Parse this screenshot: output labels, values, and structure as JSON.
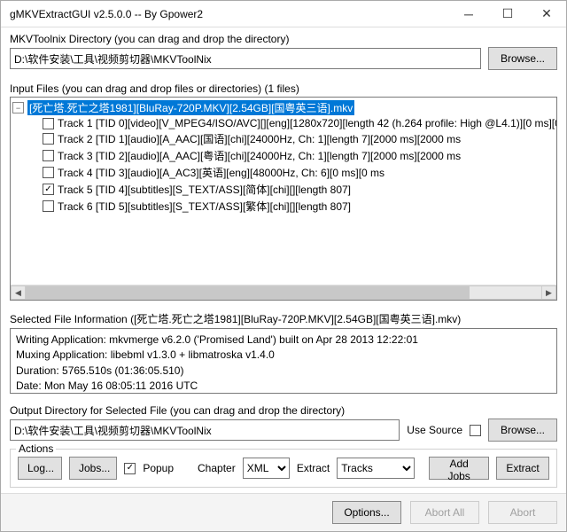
{
  "window": {
    "title": "gMKVExtractGUI v2.5.0.0 -- By Gpower2"
  },
  "mkvtoolnix": {
    "label": "MKVToolnix Directory (you can drag and drop the directory)",
    "path": "D:\\软件安装\\工具\\视频剪切器\\MKVToolNix",
    "browse": "Browse..."
  },
  "input": {
    "label": "Input Files (you can drag and drop files or directories) (1 files)",
    "root": "[死亡塔.死亡之塔1981][BluRay-720P.MKV][2.54GB][国粤英三语].mkv",
    "expander": "−",
    "tracks": [
      {
        "checked": false,
        "text": "Track 1 [TID 0][video][V_MPEG4/ISO/AVC][][eng][1280x720][length 42 (h.264 profile: High @L4.1)][0 ms][0"
      },
      {
        "checked": false,
        "text": "Track 2 [TID 1][audio][A_AAC][国语][chi][24000Hz, Ch: 1][length 7][2000 ms][2000 ms"
      },
      {
        "checked": false,
        "text": "Track 3 [TID 2][audio][A_AAC][粤语][chi][24000Hz, Ch: 1][length 7][2000 ms][2000 ms"
      },
      {
        "checked": false,
        "text": "Track 4 [TID 3][audio][A_AC3][英语][eng][48000Hz, Ch: 6][0 ms][0 ms"
      },
      {
        "checked": true,
        "text": "Track 5 [TID 4][subtitles][S_TEXT/ASS][简体][chi][][length 807]"
      },
      {
        "checked": false,
        "text": "Track 6 [TID 5][subtitles][S_TEXT/ASS][繁体][chi][][length 807]"
      }
    ]
  },
  "selected_info": {
    "label": "Selected File Information ([死亡塔.死亡之塔1981][BluRay-720P.MKV][2.54GB][国粤英三语].mkv)",
    "lines": {
      "l1": "Writing Application: mkvmerge v6.2.0 ('Promised Land') built on Apr 28 2013 12:22:01",
      "l2": "Muxing Application: libebml v1.3.0 + libmatroska v1.4.0",
      "l3": "Duration: 5765.510s (01:36:05.510)",
      "l4": "Date: Mon May 16 08:05:11 2016 UTC"
    }
  },
  "output": {
    "label": "Output Directory for Selected File (you can drag and drop the directory)",
    "path": "D:\\软件安装\\工具\\视频剪切器\\MKVToolNix",
    "use_source_label": "Use Source",
    "use_source_checked": false,
    "browse": "Browse..."
  },
  "actions": {
    "legend": "Actions",
    "log": "Log...",
    "jobs": "Jobs...",
    "popup_label": "Popup",
    "popup_checked": true,
    "chapter_label": "Chapter",
    "chapter_value": "XML",
    "extract_label": "Extract",
    "extract_value": "Tracks",
    "add_jobs": "Add Jobs",
    "extract_btn": "Extract"
  },
  "bottom": {
    "options": "Options...",
    "abort_all": "Abort All",
    "abort": "Abort"
  }
}
